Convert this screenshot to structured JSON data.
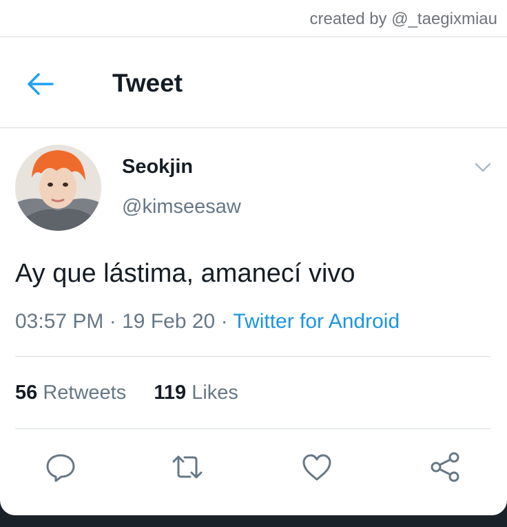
{
  "watermark": "created by @_taegixmiau",
  "header": {
    "back_icon": "arrow-left-icon",
    "title": "Tweet"
  },
  "tweet": {
    "author_name": "Seokjin",
    "author_handle": "@kimseesaw",
    "text": "Ay que lástima, amanecí vivo",
    "time": "03:57 PM",
    "date": "19 Feb 20",
    "separator": "·",
    "source": "Twitter for Android"
  },
  "stats": {
    "retweets_count": "56",
    "retweets_label": "Retweets",
    "likes_count": "119",
    "likes_label": "Likes"
  },
  "actions": [
    "reply-icon",
    "retweet-icon",
    "like-icon",
    "share-icon"
  ],
  "colors": {
    "accent": "#1b95e0",
    "text": "#141d26",
    "secondary": "#657786",
    "divider": "#d7dbe0"
  }
}
